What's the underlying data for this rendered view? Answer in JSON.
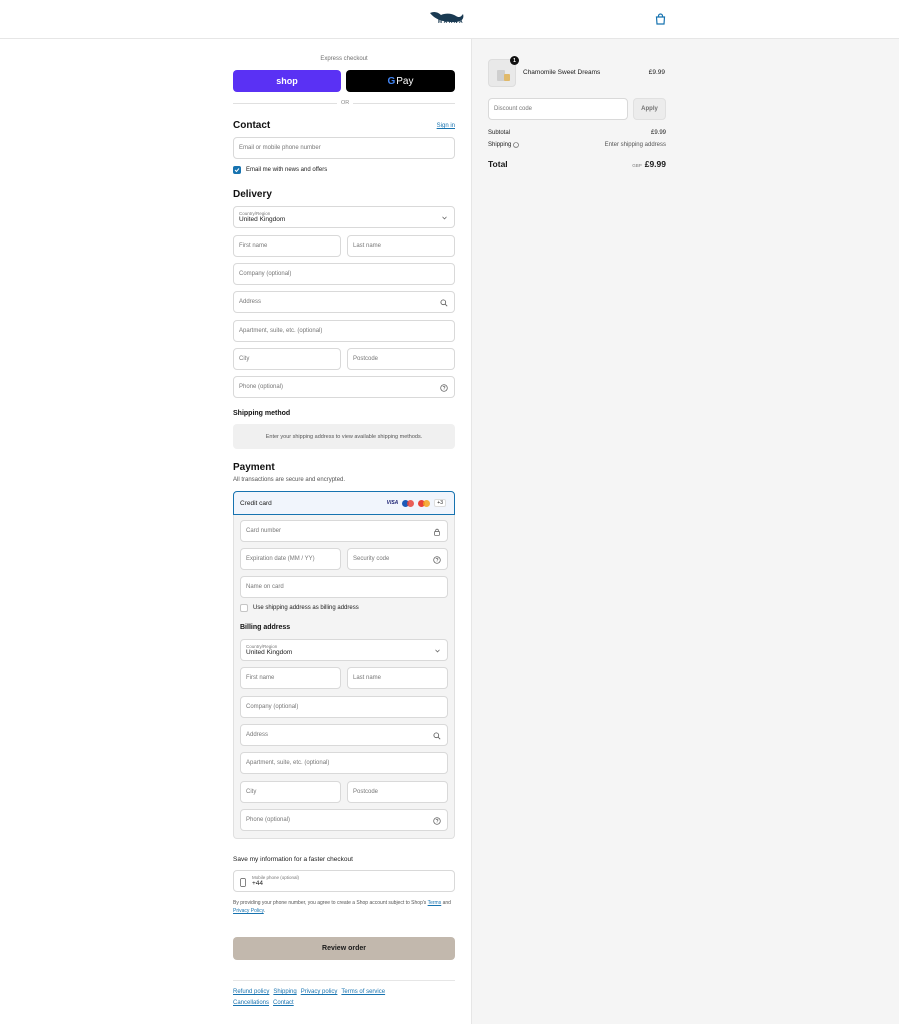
{
  "header": {
    "brand": "MARNA"
  },
  "express": {
    "label": "Express checkout",
    "shop_label": "shop",
    "gpay_g": "G",
    "gpay_pay": "Pay",
    "or_label": "OR"
  },
  "contact": {
    "title": "Contact",
    "sign_in": "Sign in",
    "email_placeholder": "Email or mobile phone number",
    "news_label": "Email me with news and offers"
  },
  "delivery": {
    "title": "Delivery",
    "country_label": "Country/Region",
    "country_value": "United Kingdom",
    "first_name": "First name",
    "last_name": "Last name",
    "company": "Company (optional)",
    "address": "Address",
    "apartment": "Apartment, suite, etc. (optional)",
    "city": "City",
    "postcode": "Postcode",
    "phone": "Phone (optional)"
  },
  "shipping": {
    "title": "Shipping method",
    "message": "Enter your shipping address to view available shipping methods."
  },
  "payment": {
    "title": "Payment",
    "subtitle": "All transactions are secure and encrypted.",
    "method": "Credit card",
    "visa": "VISA",
    "more_cards": "+3",
    "card_number": "Card number",
    "expiration": "Expiration date (MM / YY)",
    "security_code": "Security code",
    "name_on_card": "Name on card",
    "same_billing": "Use shipping address as billing address"
  },
  "billing": {
    "title": "Billing address",
    "country_label": "Country/Region",
    "country_value": "United Kingdom",
    "first_name": "First name",
    "last_name": "Last name",
    "company": "Company (optional)",
    "address": "Address",
    "apartment": "Apartment, suite, etc. (optional)",
    "city": "City",
    "postcode": "Postcode",
    "phone": "Phone (optional)"
  },
  "save_info": {
    "title": "Save my information for a faster checkout",
    "mobile_label": "Mobile phone (optional)",
    "mobile_value": "+44",
    "terms_pre": "By providing your phone number, you agree to create a Shop account subject to Shop's ",
    "terms_link": "Terms",
    "terms_and": " and ",
    "privacy_link": "Privacy Policy",
    "terms_end": "."
  },
  "review_button": "Review order",
  "footer": {
    "links": [
      "Refund policy",
      "Shipping",
      "Privacy policy",
      "Terms of service",
      "Cancellations",
      "Contact"
    ]
  },
  "summary": {
    "product_name": "Chamomile Sweet Dreams",
    "product_qty": "1",
    "product_price": "£9.99",
    "discount_placeholder": "Discount code",
    "apply_label": "Apply",
    "subtotal_label": "Subtotal",
    "subtotal_value": "£9.99",
    "shipping_label": "Shipping",
    "shipping_value": "Enter shipping address",
    "total_label": "Total",
    "currency": "GBP",
    "total_value": "£9.99"
  },
  "colors": {
    "accent": "#1773b0",
    "shop_purple": "#5a31f4",
    "review_btn": "#c2b8ad",
    "brand_navy": "#1a3a52"
  },
  "icons": [
    "whale-logo-icon",
    "shopping-bag-icon",
    "search-icon",
    "help-circle-icon",
    "lock-icon",
    "chevron-down-icon",
    "mobile-phone-icon",
    "check-icon"
  ]
}
